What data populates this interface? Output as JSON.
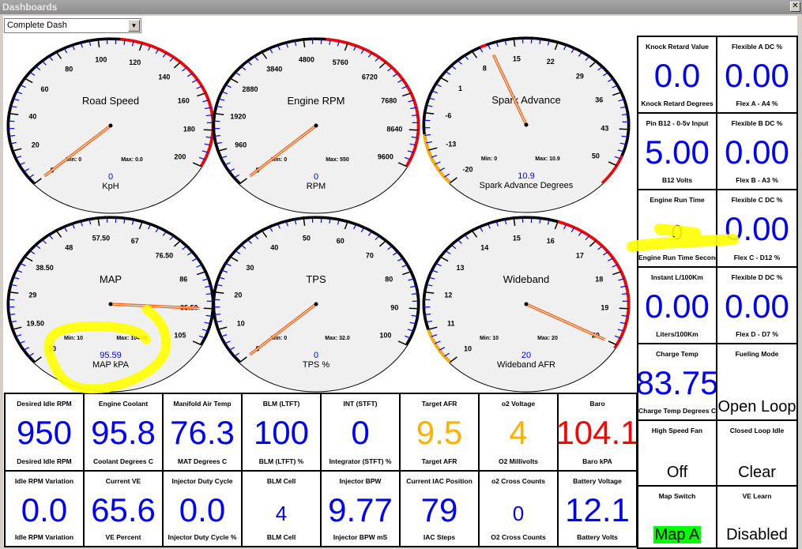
{
  "window": {
    "title": "Dashboards",
    "close_icon": "close-icon"
  },
  "dashboard_select": {
    "value": "Complete Dash"
  },
  "colors": {
    "value_blue": "#0000ff",
    "value_orange": "#ffb000",
    "value_red": "#ff0000",
    "status_black": "#000000",
    "map_a_bg": "#00ff00",
    "needle": "#ff5500",
    "zone_red": "#ff0000",
    "zone_orange": "#ffb000",
    "minor_tick": "#0000ff"
  },
  "gauges": [
    {
      "title": "Road Speed",
      "units": "KpH",
      "value_text": "0",
      "value": 0,
      "min": 0,
      "max": 200,
      "labels": [
        "0",
        "20",
        "40",
        "60",
        "80",
        "100",
        "120",
        "140",
        "160",
        "180",
        "200"
      ],
      "min_text": "Min: 0",
      "max_text": "Max: 0.0",
      "zones": [
        {
          "from": 110,
          "to": 200,
          "color": "red"
        }
      ]
    },
    {
      "title": "Engine RPM",
      "units": "RPM",
      "value_text": "0",
      "value": 0,
      "min": 0,
      "max": 9600,
      "labels": [
        "0",
        "960",
        "1920",
        "2880",
        "3840",
        "4800",
        "5760",
        "6720",
        "7680",
        "8640",
        "9600"
      ],
      "min_text": "Min: 0",
      "max_text": "Max: 550",
      "zones": [
        {
          "from": 5280,
          "to": 9600,
          "color": "red"
        }
      ]
    },
    {
      "title": "Spark Advance",
      "units": "Spark Advance Degrees",
      "value_text": "10.9",
      "value": 10.9,
      "min": -20,
      "max": 50,
      "labels": [
        "-20",
        "-13",
        "-6",
        "1",
        "8",
        "15",
        "22",
        "29",
        "36",
        "43",
        "50"
      ],
      "min_text": "Min: 0",
      "max_text": "Max: 10.9",
      "zones": [
        {
          "from": -20,
          "to": -10,
          "color": "orange"
        },
        {
          "from": 9.5,
          "to": 10.5,
          "color": "red"
        },
        {
          "from": 48,
          "to": 54,
          "color": "red"
        }
      ]
    },
    {
      "title": "MAP",
      "units": "MAP kPA",
      "value_text": "95.59",
      "value": 95.59,
      "min": 10,
      "max": 105,
      "labels": [
        "10",
        "19.50",
        "29",
        "38.50",
        "48",
        "57.50",
        "67",
        "76.50",
        "86",
        "95.50",
        "105"
      ],
      "min_text": "Min: 10",
      "max_text": "Max: 104.08",
      "zones": []
    },
    {
      "title": "TPS",
      "units": "TPS %",
      "value_text": "0",
      "value": 0,
      "min": 0,
      "max": 100,
      "labels": [
        "0",
        "10",
        "20",
        "30",
        "40",
        "50",
        "60",
        "70",
        "80",
        "90",
        "100"
      ],
      "min_text": "Min: 0",
      "max_text": "Max: 32.0",
      "zones": []
    },
    {
      "title": "Wideband",
      "units": "Wideband AFR",
      "value_text": "20",
      "value": 20,
      "min": 10,
      "max": 20,
      "labels": [
        "10",
        "11",
        "12",
        "13",
        "14",
        "15",
        "16",
        "17",
        "18",
        "19",
        "20"
      ],
      "min_text": "Min: 10",
      "max_text": "Max: 20",
      "zones": [
        {
          "from": 10,
          "to": 11,
          "color": "orange"
        },
        {
          "from": 16,
          "to": 20.1,
          "color": "red"
        }
      ]
    }
  ],
  "bottom_grid": [
    {
      "title": "Desired Idle RPM",
      "value": "950",
      "unit": "Desired Idle RPM",
      "color": "blue"
    },
    {
      "title": "Engine Coolant",
      "value": "95.8",
      "unit": "Coolant Degrees C",
      "color": "blue"
    },
    {
      "title": "Manifold Air Temp",
      "value": "76.3",
      "unit": "MAT Degrees C",
      "color": "blue"
    },
    {
      "title": "BLM (LTFT)",
      "value": "100",
      "unit": "BLM (LTFT) %",
      "color": "blue"
    },
    {
      "title": "INT (STFT)",
      "value": "0",
      "unit": "Integrator (STFT) %",
      "color": "blue"
    },
    {
      "title": "Target AFR",
      "value": "9.5",
      "unit": "Target AFR",
      "color": "orange"
    },
    {
      "title": "o2 Voltage",
      "value": "4",
      "unit": "O2 Millivolts",
      "color": "orange"
    },
    {
      "title": "Baro",
      "value": "104.1",
      "unit": "Baro kPA",
      "color": "red"
    },
    {
      "title": "Idle RPM Variation",
      "value": "0.0",
      "unit": "Idle RPM Variation",
      "color": "blue"
    },
    {
      "title": "Current VE",
      "value": "65.6",
      "unit": "VE Percent",
      "color": "blue"
    },
    {
      "title": "Injector Duty Cycle",
      "value": "0.0",
      "unit": "Injector Duty Cycle %",
      "color": "blue"
    },
    {
      "title": "BLM Cell",
      "value": "4",
      "unit": "BLM Cell",
      "color": "blue",
      "small": true
    },
    {
      "title": "Injector BPW",
      "value": "9.77",
      "unit": "Injector BPW mS",
      "color": "blue"
    },
    {
      "title": "Current IAC Position",
      "value": "79",
      "unit": "IAC Steps",
      "color": "blue"
    },
    {
      "title": "o2 Cross Counts",
      "value": "0",
      "unit": "O2 Cross Counts",
      "color": "blue",
      "small": true
    },
    {
      "title": "Battery Voltage",
      "value": "12.1",
      "unit": "Battery Volts",
      "color": "blue"
    }
  ],
  "right_panel": [
    {
      "title": "Knock Retard Value",
      "value": "0.0",
      "unit": "Knock Retard Degrees",
      "color": "blue"
    },
    {
      "title": "Flexible A DC %",
      "value": "0.00",
      "unit": "Flex A - A4 %",
      "color": "blue"
    },
    {
      "title": "Pin B12 - 0-5v Input",
      "value": "5.00",
      "unit": "B12 Volts",
      "color": "blue"
    },
    {
      "title": "Flexible B DC %",
      "value": "0.00",
      "unit": "Flex B - A3 %",
      "color": "blue"
    },
    {
      "title": "Engine Run Time",
      "value": "0",
      "unit": "Engine Run Time Seconds",
      "color": "black",
      "small": true
    },
    {
      "title": "Flexible C DC %",
      "value": "0.00",
      "unit": "Flex C - D12 %",
      "color": "blue"
    },
    {
      "title": "Instant L/100Km",
      "value": "0.00",
      "unit": "Liters/100Km",
      "color": "blue"
    },
    {
      "title": "Flexible D DC %",
      "value": "0.00",
      "unit": "Flex D - D7 %",
      "color": "blue"
    },
    {
      "title": "Charge Temp",
      "value": "83.75",
      "unit": "Charge Temp Degrees C",
      "color": "blue"
    },
    {
      "title": "Fueling Mode",
      "value": "Open Loop",
      "unit": "",
      "color": "black",
      "status": true
    },
    {
      "title": "High Speed Fan",
      "value": "Off",
      "unit": "",
      "color": "black",
      "status": true
    },
    {
      "title": "Closed Loop Idle",
      "value": "Clear",
      "unit": "",
      "color": "black",
      "status": true
    },
    {
      "title": "Map Switch",
      "value": "Map A",
      "unit": "",
      "color": "black",
      "status": true,
      "highlight": "#00ff00"
    },
    {
      "title": "VE Learn",
      "value": "Disabled",
      "unit": "",
      "color": "black",
      "status": true
    }
  ]
}
